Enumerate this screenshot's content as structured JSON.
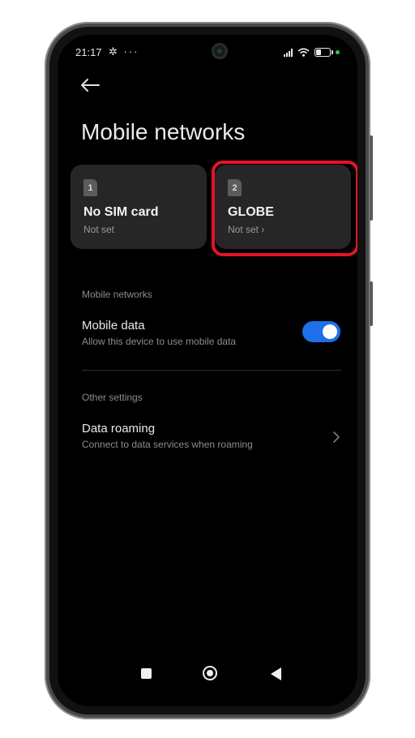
{
  "status_bar": {
    "time": "21:17",
    "extra_icons": "✲ ···"
  },
  "page": {
    "title": "Mobile networks"
  },
  "sim_cards": [
    {
      "slot": "1",
      "name": "No SIM card",
      "status": "Not set"
    },
    {
      "slot": "2",
      "name": "GLOBE",
      "status": "Not set ›"
    }
  ],
  "mobile_networks_section": {
    "header": "Mobile networks",
    "mobile_data": {
      "title": "Mobile data",
      "subtitle": "Allow this device to use mobile data",
      "enabled": true
    }
  },
  "other_settings_section": {
    "header": "Other settings",
    "data_roaming": {
      "title": "Data roaming",
      "subtitle": "Connect to data services when roaming"
    }
  },
  "colors": {
    "toggle_on": "#1f6fe8",
    "highlight": "#e3142b",
    "background": "#000000"
  }
}
